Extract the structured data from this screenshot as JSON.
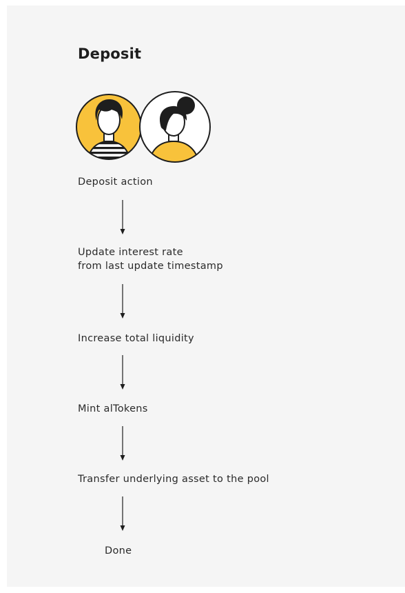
{
  "diagram": {
    "title": "Deposit",
    "icons": [
      "man-avatar-icon",
      "woman-avatar-icon"
    ],
    "colors": {
      "accent": "#F8C23B",
      "background": "#F5F5F5",
      "line": "#1E1E1E"
    },
    "steps": [
      {
        "lines": [
          "Deposit action"
        ]
      },
      {
        "lines": [
          "Update interest rate",
          "from last update timestamp"
        ]
      },
      {
        "lines": [
          "Increase total liquidity"
        ]
      },
      {
        "lines": [
          "Mint alTokens"
        ]
      },
      {
        "lines": [
          "Transfer underlying asset to the pool"
        ]
      },
      {
        "lines": [
          "Done"
        ]
      }
    ]
  }
}
